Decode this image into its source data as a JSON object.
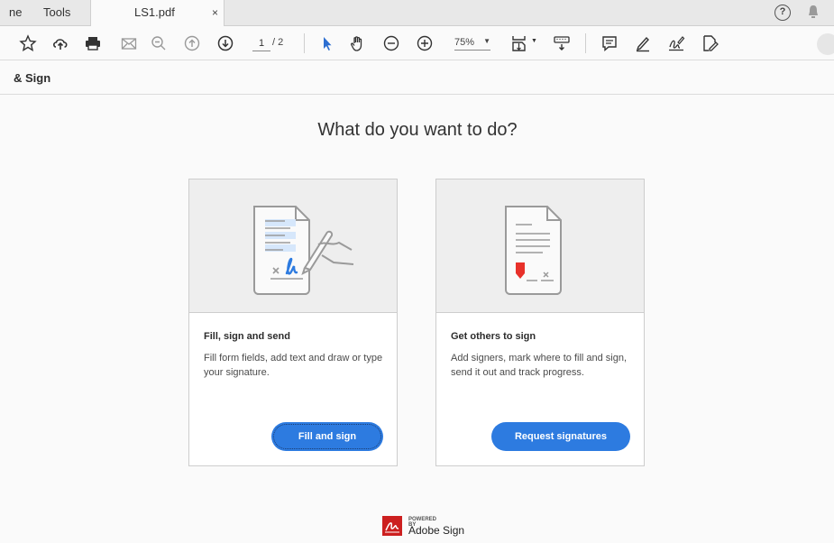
{
  "tabs": {
    "home": "ne",
    "tools": "Tools",
    "document": "LS1.pdf",
    "close": "×"
  },
  "header": {
    "help": "?"
  },
  "toolbar": {
    "page_current": "1",
    "page_total": "/ 2",
    "zoom": "75%",
    "zoom_caret": "▼",
    "icons": [
      "star-icon",
      "upload-cloud-icon",
      "print-icon",
      "email-icon",
      "search-zoom-icon",
      "page-up-icon",
      "page-down-icon",
      "select-pointer-icon",
      "hand-pan-icon",
      "zoom-out-icon",
      "zoom-in-icon",
      "fit-page-icon",
      "keyboard-icon",
      "comment-icon",
      "highlight-pen-icon",
      "sign-icon",
      "edit-pdf-icon"
    ]
  },
  "subheader": {
    "title": "& Sign"
  },
  "main": {
    "heading": "What do you want to do?"
  },
  "cards": [
    {
      "title": "Fill, sign and send",
      "description": "Fill form fields, add text and draw or type your signature.",
      "button": "Fill and sign"
    },
    {
      "title": "Get others to sign",
      "description": "Add signers, mark where to fill and sign, send it out and track progress.",
      "button": "Request signatures"
    }
  ],
  "footer": {
    "powered_by": "POWERED BY",
    "product": "Adobe Sign"
  },
  "colors": {
    "accent": "#2d7be0",
    "brand_red": "#cc1f1f",
    "marker_red": "#e8312a"
  }
}
